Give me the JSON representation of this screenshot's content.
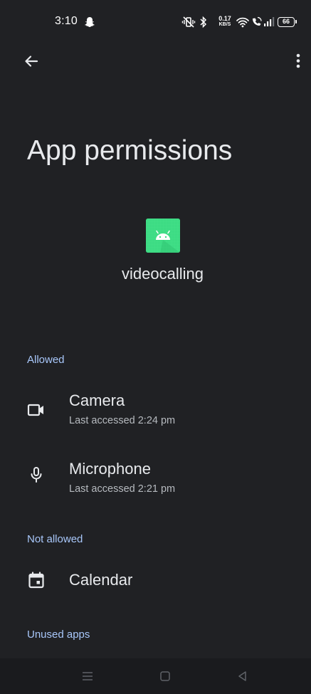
{
  "status_bar": {
    "time": "3:10",
    "net_speed_value": "0.17",
    "net_speed_unit": "KB/S",
    "battery": "66",
    "icons": [
      "snapchat-icon",
      "mute-vibrate-icon",
      "bluetooth-icon",
      "wifi-icon",
      "wifi-calling-icon",
      "signal-icon",
      "battery-icon"
    ]
  },
  "toolbar": {
    "back_icon": "arrow-back-icon",
    "more_icon": "more-vert-icon"
  },
  "page": {
    "title": "App permissions"
  },
  "app": {
    "icon": "android-icon",
    "name": "videocalling",
    "icon_color": "#3ddc84"
  },
  "sections": {
    "allowed": {
      "header": "Allowed",
      "items": [
        {
          "icon": "videocam-icon",
          "title": "Camera",
          "subtitle": "Last accessed 2:24 pm"
        },
        {
          "icon": "mic-icon",
          "title": "Microphone",
          "subtitle": "Last accessed 2:21 pm"
        }
      ]
    },
    "not_allowed": {
      "header": "Not allowed",
      "items": [
        {
          "icon": "calendar-icon",
          "title": "Calendar"
        }
      ]
    },
    "unused": {
      "header": "Unused apps"
    }
  },
  "nav_bar": {
    "buttons": [
      "menu-icon",
      "home-icon",
      "back-triangle-icon"
    ]
  },
  "colors": {
    "background": "#202124",
    "accent": "#a8c7fa",
    "text_primary": "#e8eaed",
    "text_secondary": "#b6babf"
  }
}
